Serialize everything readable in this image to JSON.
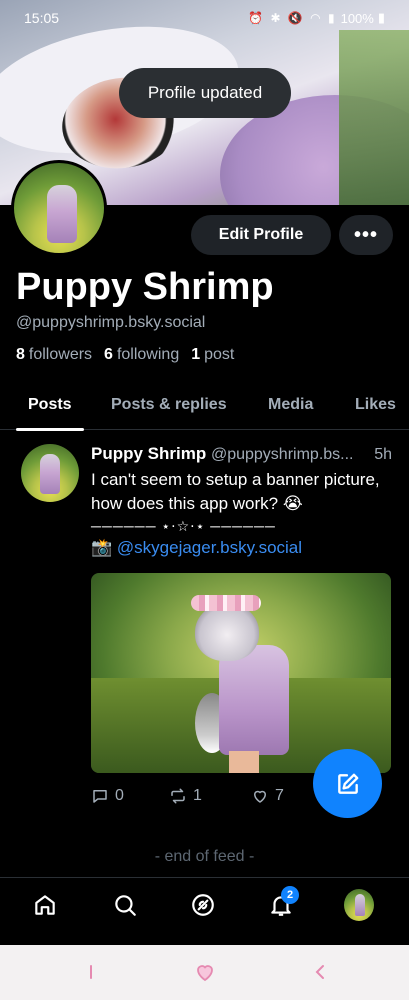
{
  "status_bar": {
    "time": "15:05",
    "battery": "100%"
  },
  "toast": {
    "text": "Profile updated"
  },
  "profile": {
    "edit_label": "Edit Profile",
    "more_label": "•••",
    "display_name": "Puppy Shrimp",
    "handle": "@puppyshrimp.bsky.social",
    "followers_count": "8",
    "followers_label": "followers",
    "following_count": "6",
    "following_label": "following",
    "posts_count": "1",
    "posts_label": "post"
  },
  "tabs": [
    {
      "label": "Posts",
      "active": true
    },
    {
      "label": "Posts & replies",
      "active": false
    },
    {
      "label": "Media",
      "active": false
    },
    {
      "label": "Likes",
      "active": false
    }
  ],
  "post": {
    "author_name": "Puppy Shrimp",
    "author_handle": "@puppyshrimp.bs...",
    "time": "5h",
    "text": "I can't seem to setup a banner picture, how does this app work? 😭",
    "divider": "────── ⋆⋅☆⋅⋆ ──────",
    "credit_emoji": "📸",
    "credit_link": "@skygejager.bsky.social",
    "reply_count": "0",
    "repost_count": "1",
    "like_count": "7"
  },
  "feed": {
    "end_text": "- end of feed -"
  },
  "bottom_nav": {
    "notifications_badge": "2"
  },
  "colors": {
    "accent": "#1083fe",
    "muted": "#a3adb8",
    "background": "#000000"
  }
}
